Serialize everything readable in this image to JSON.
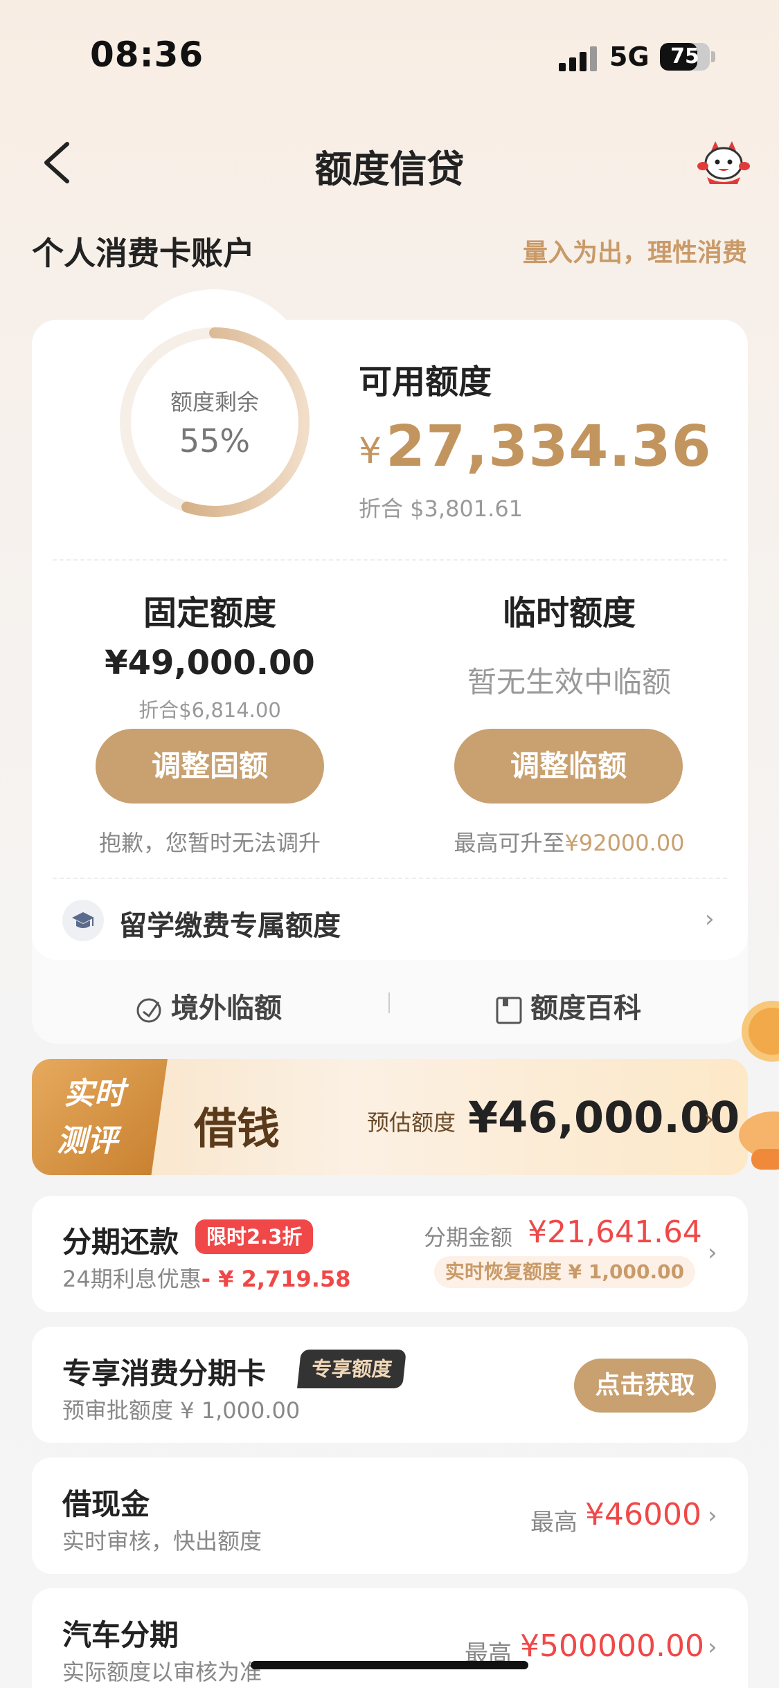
{
  "status_bar": {
    "time": "08:36",
    "network": "5G",
    "battery": "75",
    "battery_level": 0.75
  },
  "header": {
    "title": "额度信贷"
  },
  "account": {
    "title": "个人消费卡账户",
    "slogan": "量入为出，理性消费"
  },
  "credit": {
    "ring_label": "额度剩余",
    "ring_percent": "55%",
    "remaining_fraction": 0.55,
    "available_label": "可用额度",
    "currency": "¥",
    "available_amount": "27,334.36",
    "available_converted": "折合 $3,801.61"
  },
  "fixed": {
    "title": "固定额度",
    "amount": "¥49,000.00",
    "converted": "折合$6,814.00",
    "button": "调整固额",
    "note": "抱歉，您暂时无法调升"
  },
  "temporary": {
    "title": "临时额度",
    "status": "暂无生效中临额",
    "button": "调整临额",
    "note_prefix": "最高可升至",
    "note_value": "¥92000.00"
  },
  "study": {
    "label": "留学缴费专属额度"
  },
  "links": {
    "overseas": "境外临额",
    "wiki": "额度百科"
  },
  "loan_banner": {
    "badge_line1": "实时",
    "badge_line2": "测评",
    "title": "借钱",
    "estimate_label": "预估额度",
    "estimate_amount": "¥46,000.00"
  },
  "installment": {
    "title": "分期还款",
    "tag": "限时2.3折",
    "sub_label": "24期利息优惠",
    "sub_value": "- ¥ 2,719.58",
    "amount_label": "分期金额",
    "amount": "¥21,641.64",
    "restore": "实时恢复额度 ¥ 1,000.00"
  },
  "exclusive_card": {
    "title": "专享消费分期卡",
    "tag": "专享额度",
    "sub": "预审批额度 ¥ 1,000.00",
    "button": "点击获取"
  },
  "cash_loan": {
    "title": "借现金",
    "sub": "实时审核，快出额度",
    "max_label": "最高",
    "max_value": "¥46000"
  },
  "car_loan": {
    "title": "汽车分期",
    "sub": "实际额度以审核为准",
    "max_label": "最高",
    "max_value": "¥500000.00"
  },
  "colors": {
    "gold": "#c9a06f",
    "red": "#f04848",
    "accent_text": "#c2955f"
  },
  "icons": [
    "back-arrow-icon",
    "mascot-icon",
    "graduation-cap-icon",
    "chevron-right-icon",
    "overseas-icon",
    "book-icon"
  ]
}
